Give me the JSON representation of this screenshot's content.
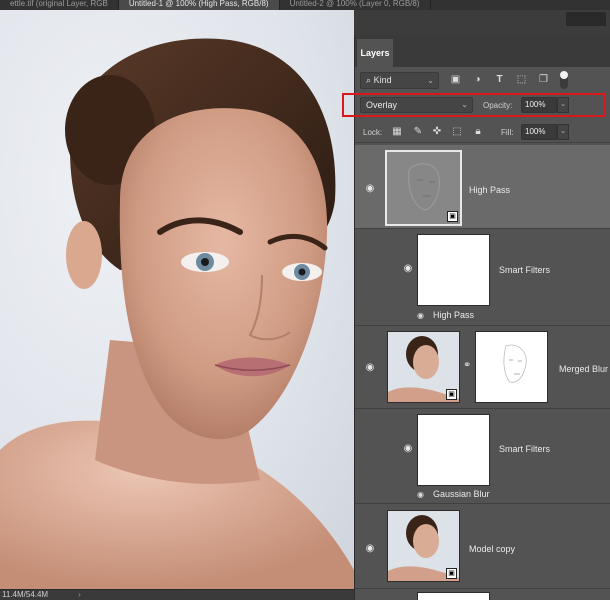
{
  "doc_tabs": [
    {
      "label": "ettle.tif (original Layer, RGB",
      "active": false
    },
    {
      "label": "Untitled-1 @ 100% (High Pass, RGB/8)",
      "active": true
    },
    {
      "label": "Untitled-2 @ 100% (Layer 0, RGB/8)",
      "active": false
    }
  ],
  "status": {
    "doc_size": "11.4M/54.4M",
    "arrow": "›"
  },
  "panel": {
    "tab": "Layers"
  },
  "filter": {
    "kind_label": "Kind"
  },
  "blend": {
    "mode": "Overlay",
    "opacity_label": "Opacity:",
    "opacity_value": "100%"
  },
  "lock": {
    "label": "Lock:",
    "fill_label": "Fill:",
    "fill_value": "100%"
  },
  "layers": [
    {
      "name": "High Pass",
      "selected": true
    },
    {
      "name": "Smart Filters",
      "filter_name": "High Pass"
    },
    {
      "name": "Merged Blur"
    },
    {
      "name": "Smart Filters",
      "filter_name": "Gaussian Blur"
    },
    {
      "name": "Model  copy"
    }
  ],
  "icons": {
    "eye": "eye-icon",
    "caret": "chevron-down-icon",
    "smart_badge": "smart-object-icon",
    "chain": "link-icon"
  },
  "colors": {
    "highlight": "#d7191c",
    "panel_bg": "#535353",
    "selected_row": "#6a6a6a"
  }
}
